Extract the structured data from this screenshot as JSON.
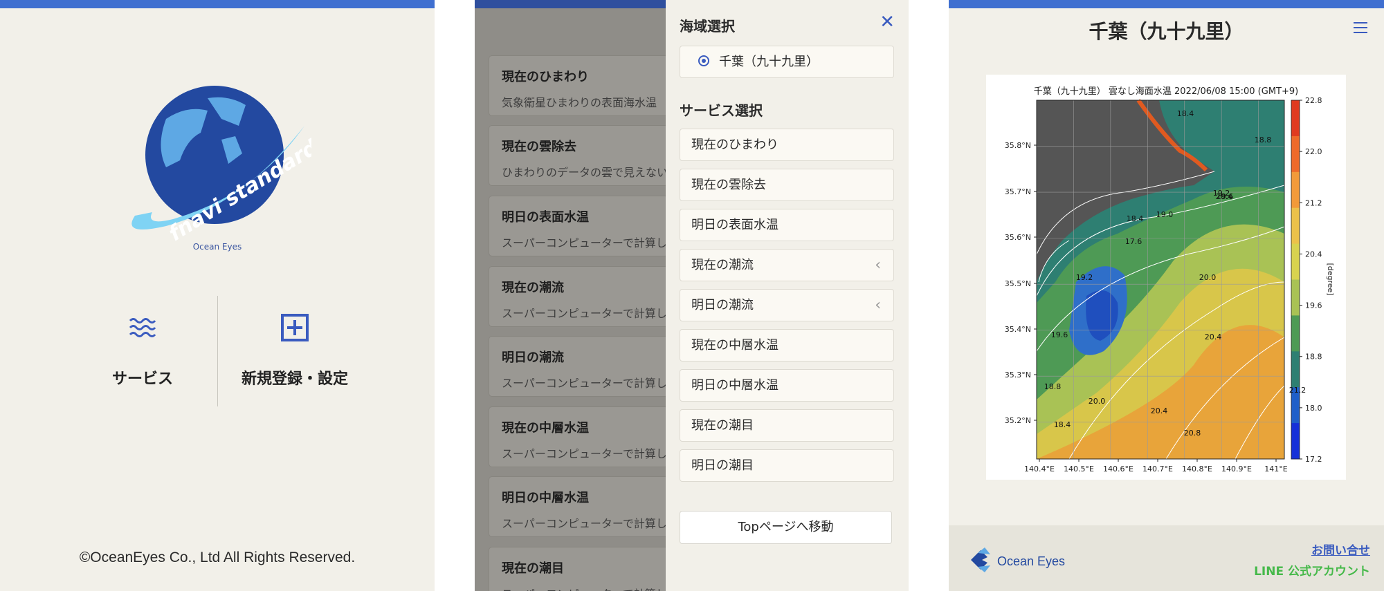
{
  "screen1": {
    "logo_text": "fnavi standard",
    "logo_caption": "Ocean Eyes",
    "menu": [
      {
        "label": "サービス",
        "icon": "waves-icon"
      },
      {
        "label": "新規登録・設定",
        "icon": "plus-square-icon"
      }
    ],
    "copyright": "©OceanEyes Co., Ltd All Rights Reserved."
  },
  "screen2": {
    "background_cards": [
      {
        "title": "現在のひまわり",
        "desc": "気象衛星ひまわりの表面海水温"
      },
      {
        "title": "現在の雲除去",
        "desc": "ひまわりのデータの雲で見えない"
      },
      {
        "title": "明日の表面水温",
        "desc": "スーパーコンピューターで計算し"
      },
      {
        "title": "現在の潮流",
        "desc": "スーパーコンピューターで計算し"
      },
      {
        "title": "明日の潮流",
        "desc": "スーパーコンピューターで計算し"
      },
      {
        "title": "現在の中層水温",
        "desc": "スーパーコンピューターで計算し"
      },
      {
        "title": "明日の中層水温",
        "desc": "スーパーコンピューターで計算し"
      },
      {
        "title": "現在の潮目",
        "desc": "スーパーコンピューターで計算し"
      }
    ],
    "drawer": {
      "area_heading": "海域選択",
      "area_option": "千葉（九十九里）",
      "service_heading": "サービス選択",
      "services": [
        "現在のひまわり",
        "現在の雲除去",
        "明日の表面水温",
        "現在の潮流",
        "明日の潮流",
        "現在の中層水温",
        "明日の中層水温",
        "現在の潮目",
        "明日の潮目"
      ],
      "top_button": "Topページへ移動"
    }
  },
  "screen3": {
    "title": "千葉（九十九里）",
    "footer_logo": "Ocean Eyes",
    "contact_link": "お問い合せ",
    "line_link": "LINE 公式アカウント"
  },
  "chart_data": {
    "type": "heatmap",
    "title": "千葉（九十九里） 雲なし海面水温 2022/06/08 15:00 (GMT+9)",
    "x_ticks": [
      "140.4°E",
      "140.5°E",
      "140.6°E",
      "140.7°E",
      "140.8°E",
      "140.9°E",
      "141°E"
    ],
    "y_ticks": [
      "35.8°N",
      "35.7°N",
      "35.6°N",
      "35.5°N",
      "35.4°N",
      "35.3°N",
      "35.2°N"
    ],
    "colorbar_ticks": [
      "22.8",
      "22.0",
      "21.2",
      "20.4",
      "19.6",
      "18.8",
      "18.0",
      "17.2"
    ],
    "colorbar_label": "[degree]",
    "zlim": [
      17.2,
      22.8
    ],
    "contour_labels": [
      "18.4",
      "18.8",
      "19.2",
      "19.6",
      "18.4",
      "19.0",
      "17.6",
      "19.2",
      "19.6",
      "20.0",
      "20.4",
      "18.8",
      "20.0",
      "20.4",
      "20.8",
      "21.2",
      "18.4",
      "20.4"
    ],
    "colors": {
      "land": "#555555",
      "cool": "#1f5fc9",
      "warm": "#e03a20"
    }
  }
}
